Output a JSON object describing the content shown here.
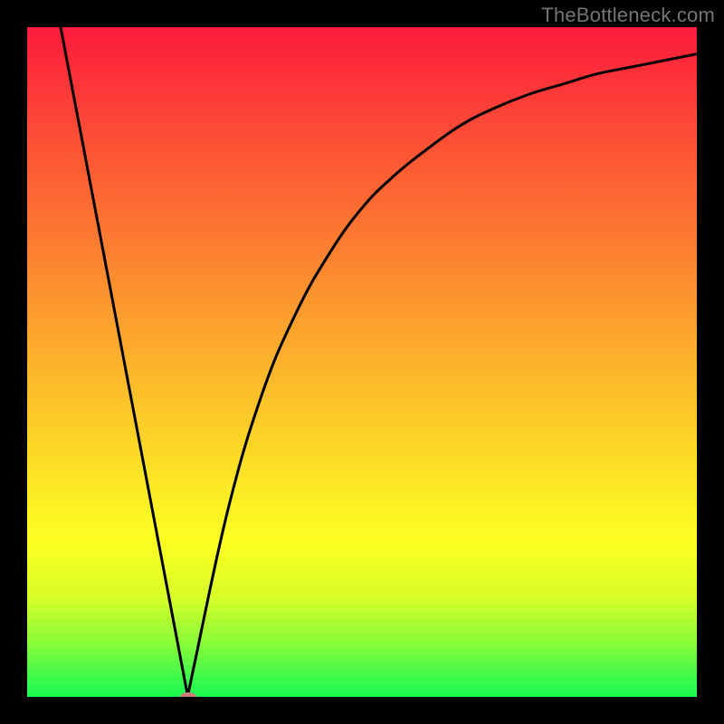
{
  "watermark": "TheBottleneck.com",
  "marker_color": "#cb7c76",
  "gradient_stops": [
    {
      "offset": 0.0,
      "color": "#fb1b3b"
    },
    {
      "offset": 0.1,
      "color": "#fc3a38"
    },
    {
      "offset": 0.2,
      "color": "#fc5934"
    },
    {
      "offset": 0.3,
      "color": "#fc7631"
    },
    {
      "offset": 0.4,
      "color": "#fc942e"
    },
    {
      "offset": 0.5,
      "color": "#fcb22b"
    },
    {
      "offset": 0.6,
      "color": "#fccf27"
    },
    {
      "offset": 0.7,
      "color": "#fced24"
    },
    {
      "offset": 0.77,
      "color": "#fcff22"
    },
    {
      "offset": 0.85,
      "color": "#d9fd27"
    },
    {
      "offset": 0.92,
      "color": "#88fb39"
    },
    {
      "offset": 0.97,
      "color": "#3ffa49"
    },
    {
      "offset": 1.0,
      "color": "#1bf951"
    }
  ],
  "chart_data": {
    "type": "line",
    "title": "",
    "xlabel": "",
    "ylabel": "",
    "xlim": [
      0,
      100
    ],
    "ylim": [
      0,
      100
    ],
    "grid": false,
    "series": [
      {
        "name": "bottleneck-curve",
        "x": [
          5,
          10,
          15,
          20,
          24,
          25,
          30,
          35,
          40,
          45,
          50,
          55,
          60,
          65,
          70,
          75,
          80,
          85,
          90,
          95,
          100
        ],
        "values": [
          100,
          75,
          50,
          25,
          0,
          5,
          28,
          45,
          57,
          66,
          73,
          78,
          82,
          85.5,
          88,
          90,
          91.5,
          93,
          94,
          95,
          96
        ]
      }
    ],
    "annotations": [
      {
        "type": "marker",
        "x": 24,
        "y": 0,
        "name": "optimal-point"
      }
    ]
  }
}
